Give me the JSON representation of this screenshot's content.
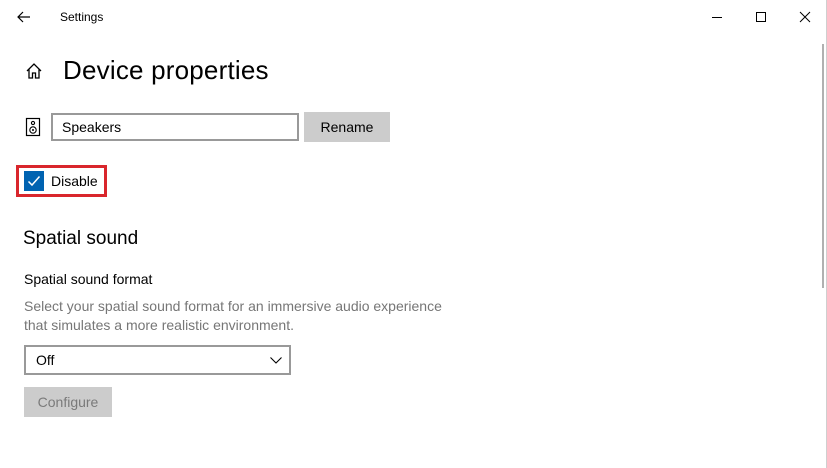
{
  "window": {
    "title": "Settings",
    "controls": [
      "minimize-icon",
      "maximize-icon",
      "close-icon"
    ]
  },
  "header": {
    "back_icon": "back-arrow-icon",
    "home_icon": "home-icon",
    "title": "Device properties"
  },
  "device": {
    "icon": "speaker-icon",
    "name_value": "Speakers",
    "rename_label": "Rename"
  },
  "disable_checkbox": {
    "label": "Disable",
    "checked": true,
    "highlight_color": "#d9262c"
  },
  "spatial_sound": {
    "heading": "Spatial sound",
    "format_label": "Spatial sound format",
    "description": "Select your spatial sound format for an immersive audio experience that simulates a more realistic environment.",
    "selected": "Off",
    "configure_label": "Configure"
  },
  "colors": {
    "accent": "#0063b1",
    "button_bg": "#cccccc",
    "muted_text": "#767676",
    "input_border": "#999999"
  }
}
